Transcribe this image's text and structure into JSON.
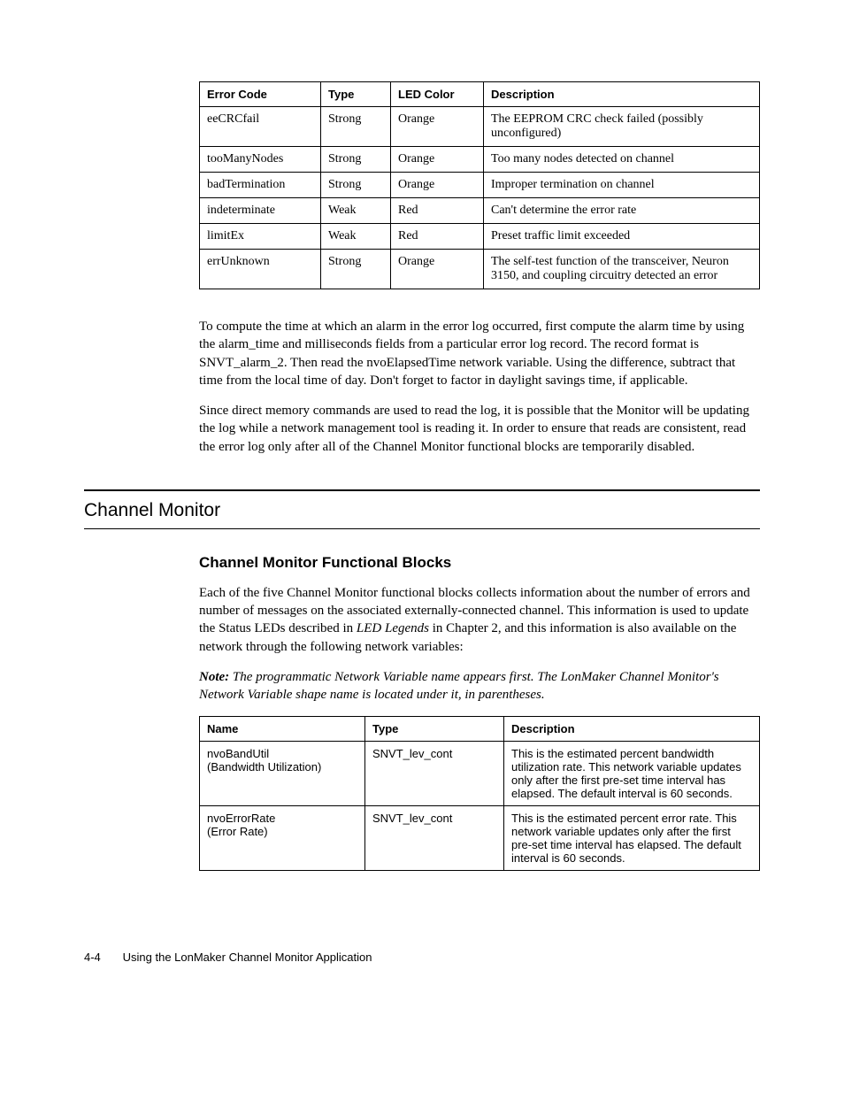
{
  "error_table": {
    "headers": [
      "Error Code",
      "Type",
      "LED Color",
      "Description"
    ],
    "rows": [
      [
        "eeCRCfail",
        "Strong",
        "Orange",
        "The EEPROM CRC check failed (possibly unconfigured)"
      ],
      [
        "tooManyNodes",
        "Strong",
        "Orange",
        "Too many nodes detected on channel"
      ],
      [
        "badTermination",
        "Strong",
        "Orange",
        "Improper termination on channel"
      ],
      [
        "indeterminate",
        "Weak",
        "Red",
        "Can't determine the error rate"
      ],
      [
        "limitEx",
        "Weak",
        "Red",
        "Preset traffic limit exceeded"
      ],
      [
        "errUnknown",
        "Strong",
        "Orange",
        "The self-test function of the transceiver, Neuron 3150, and coupling circuitry detected an error"
      ]
    ]
  },
  "para1": "To compute the time at which an alarm in the error log occurred, first compute the alarm time by using the alarm_time and milliseconds fields from a particular error log record.  The record format is SNVT_alarm_2.  Then read the nvoElapsedTime network variable.  Using the difference, subtract that time from the local time of day.  Don't forget to factor in daylight savings time, if applicable.",
  "para2": "Since direct memory commands are used to read the log, it is possible that the Monitor will be updating the log while a network management tool is reading it.  In order to ensure that reads are consistent, read the error log only after all of the Channel Monitor functional blocks are temporarily disabled.",
  "section_title": "Channel Monitor",
  "subhead": "Channel Monitor Functional Blocks",
  "para3a": "Each of the five Channel Monitor functional blocks collects information about the number of errors and number of messages on the associated externally-connected channel.  This information is used to update the Status LEDs described in ",
  "para3_em": "LED Legends",
  "para3b": " in Chapter 2, and this information is also available on the network through the following network variables:",
  "note_label": "Note:",
  "note_text": "  The programmatic Network Variable name appears first.  The LonMaker Channel Monitor's Network Variable shape name is located under it, in parentheses.",
  "nv_table": {
    "headers": [
      "Name",
      "Type",
      "Description"
    ],
    "rows": [
      {
        "name1": "nvoBandUtil",
        "name2": "(Bandwidth Utilization)",
        "type": "SNVT_lev_cont",
        "desc": "This is the estimated percent bandwidth utilization rate. This network variable updates only after the first pre-set time interval has elapsed. The default interval is 60 seconds."
      },
      {
        "name1": "nvoErrorRate",
        "name2": "(Error Rate)",
        "type": "SNVT_lev_cont",
        "desc": "This is the estimated percent error rate. This network variable updates only after the first pre-set time interval has elapsed. The default interval is 60 seconds."
      }
    ]
  },
  "footer_page": "4-4",
  "footer_text": "Using the LonMaker Channel Monitor Application"
}
